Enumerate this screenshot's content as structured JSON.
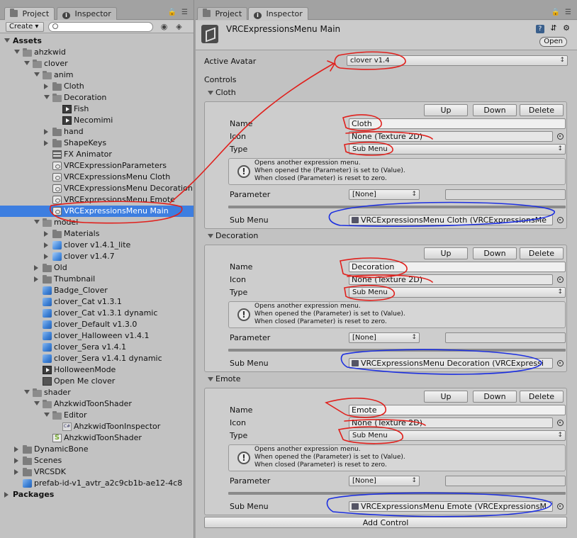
{
  "left_tabs": {
    "project": "Project",
    "inspector": "Inspector"
  },
  "toolbar": {
    "create": "Create ▾",
    "search_placeholder": ""
  },
  "tree": [
    {
      "label": "Assets",
      "bold": true
    },
    {
      "label": "ahzkwid"
    },
    {
      "label": "clover"
    },
    {
      "label": "anim"
    },
    {
      "label": "Cloth"
    },
    {
      "label": "Decoration"
    },
    {
      "label": "Fish"
    },
    {
      "label": "Necomimi"
    },
    {
      "label": "hand"
    },
    {
      "label": "ShapeKeys"
    },
    {
      "label": "FX Animator"
    },
    {
      "label": "VRCExpressionParameters"
    },
    {
      "label": "VRCExpressionsMenu Cloth"
    },
    {
      "label": "VRCExpressionsMenu Decoration"
    },
    {
      "label": "VRCExpressionsMenu Emote"
    },
    {
      "label": "VRCExpressionsMenu Main"
    },
    {
      "label": "model"
    },
    {
      "label": "Materials"
    },
    {
      "label": "clover v1.4.1_lite"
    },
    {
      "label": "clover v1.4.7"
    },
    {
      "label": "Old"
    },
    {
      "label": "Thumbnail"
    },
    {
      "label": "Badge_Clover"
    },
    {
      "label": "clover_Cat v1.3.1"
    },
    {
      "label": "clover_Cat v1.3.1 dynamic"
    },
    {
      "label": "clover_Default v1.3.0"
    },
    {
      "label": "clover_Halloween v1.4.1"
    },
    {
      "label": "clover_Sera v1.4.1"
    },
    {
      "label": "clover_Sera v1.4.1 dynamic"
    },
    {
      "label": "HolloweenMode"
    },
    {
      "label": "Open Me clover"
    },
    {
      "label": "shader"
    },
    {
      "label": "AhzkwidToonShader"
    },
    {
      "label": "Editor"
    },
    {
      "label": "AhzkwidToonInspector"
    },
    {
      "label": "AhzkwidToonShader"
    },
    {
      "label": "DynamicBone"
    },
    {
      "label": "Scenes"
    },
    {
      "label": "VRCSDK"
    },
    {
      "label": "prefab-id-v1_avtr_a2c9cb1b-ae12-4c8"
    },
    {
      "label": "Packages",
      "bold": true
    }
  ],
  "right_tabs": {
    "project": "Project",
    "inspector": "Inspector"
  },
  "inspector": {
    "title": "VRCExpressionsMenu Main",
    "open_button": "Open",
    "active_avatar_label": "Active Avatar",
    "active_avatar_value": "clover v1.4",
    "controls_label": "Controls",
    "add_control": "Add Control",
    "labels": {
      "name": "Name",
      "icon": "Icon",
      "type": "Type",
      "parameter": "Parameter",
      "sub_menu": "Sub Menu",
      "up": "Up",
      "down": "Down",
      "delete": "Delete"
    },
    "help_lines": [
      "Opens another expression menu.",
      "When opened the (Parameter) is set to (Value).",
      "When closed (Parameter) is reset to zero."
    ],
    "controls": [
      {
        "header": "Cloth",
        "name": "Cloth",
        "icon": "None (Texture 2D)",
        "type": "Sub Menu",
        "parameter": "[None]",
        "sub_menu": "VRCExpressionsMenu Cloth (VRCExpressionsMe"
      },
      {
        "header": "Decoration",
        "name": "Decoration",
        "icon": "None (Texture 2D)",
        "type": "Sub Menu",
        "parameter": "[None]",
        "sub_menu": "VRCExpressionsMenu Decoration (VRCExpressi"
      },
      {
        "header": "Emote",
        "name": "Emote",
        "icon": "None (Texture 2D)",
        "type": "Sub Menu",
        "parameter": "[None]",
        "sub_menu": "VRCExpressionsMenu Emote (VRCExpressionsM"
      }
    ]
  },
  "colors": {
    "selection": "#3d7ee0",
    "annotation_red": "#e0201c",
    "annotation_blue": "#1c2fe0"
  }
}
